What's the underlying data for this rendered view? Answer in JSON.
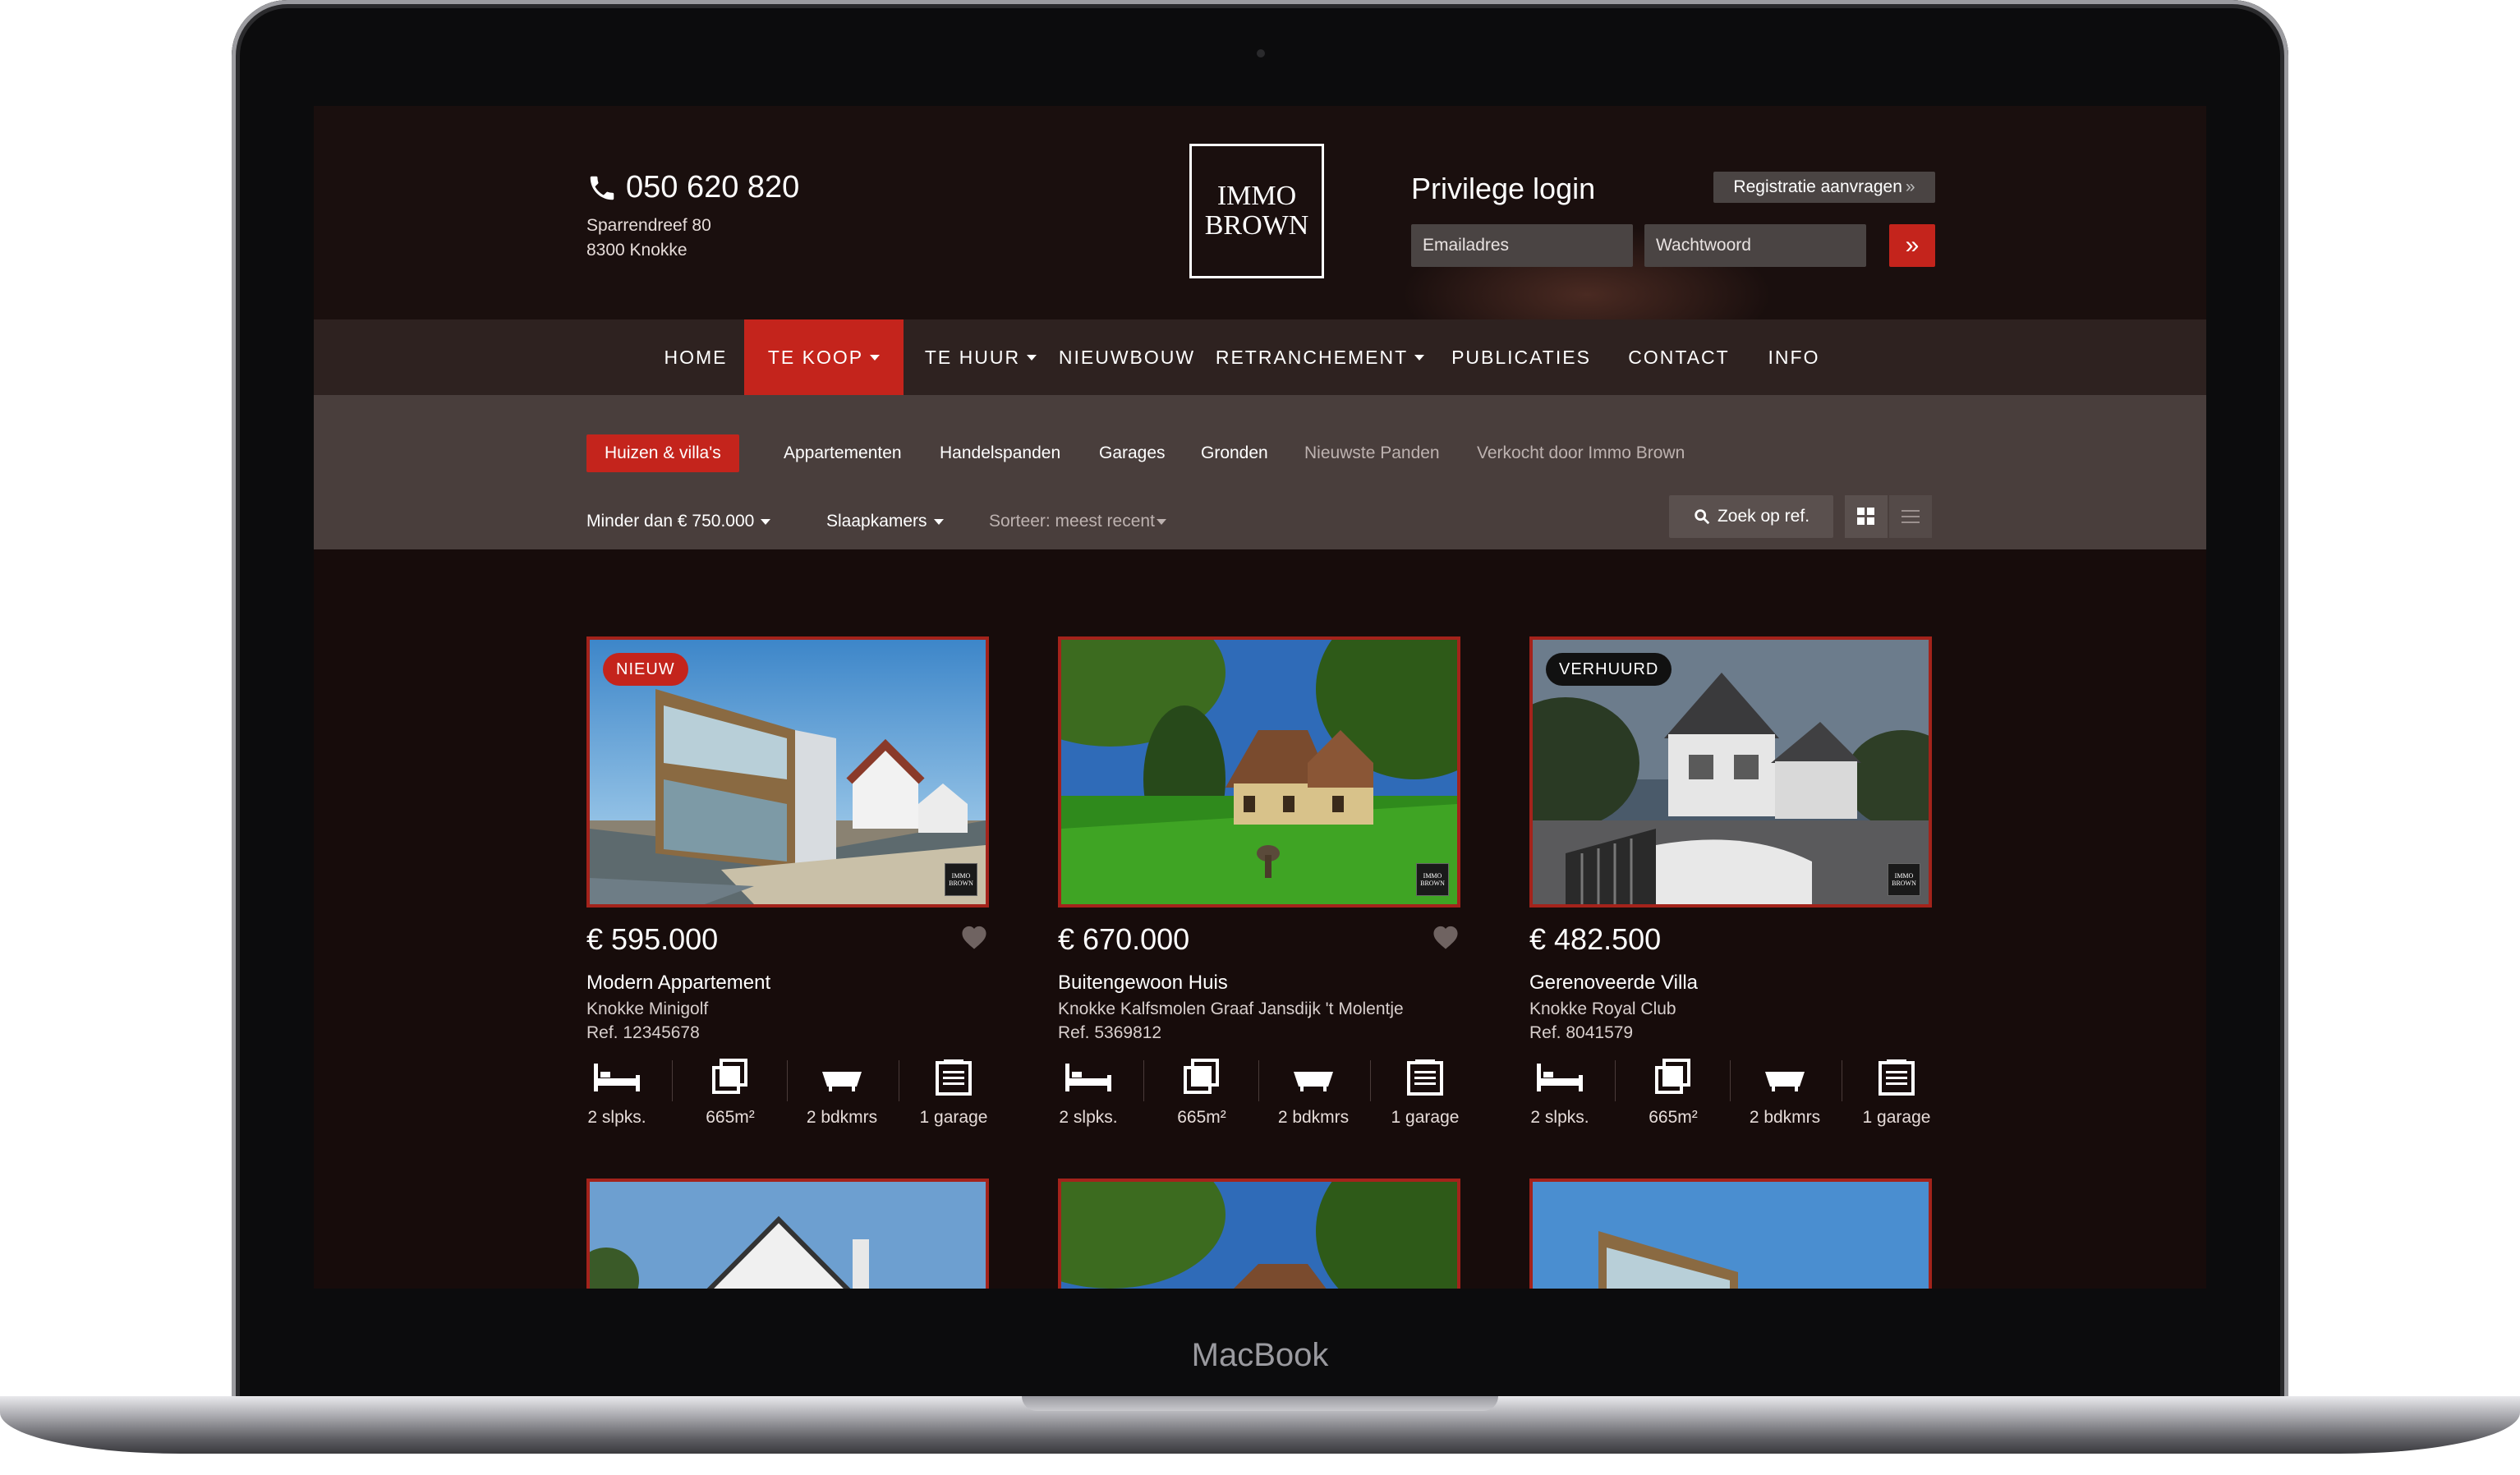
{
  "device_label": "MacBook",
  "header": {
    "phone": "050 620 820",
    "address_line1": "Sparrendreef 80",
    "address_line2": "8300 Knokke",
    "logo_line1": "IMMO",
    "logo_line2": "BROWN",
    "login_title": "Privilege login",
    "register_label": "Registratie aanvragen",
    "email_placeholder": "Emailadres",
    "password_placeholder": "Wachtwoord"
  },
  "nav": {
    "items": [
      {
        "label": "HOME"
      },
      {
        "label": "TE KOOP"
      },
      {
        "label": "TE HUUR"
      },
      {
        "label": "NIEUWBOUW"
      },
      {
        "label": "RETRANCHEMENT"
      },
      {
        "label": "PUBLICATIES"
      },
      {
        "label": "CONTACT"
      },
      {
        "label": "INFO"
      }
    ],
    "active": "TE KOOP"
  },
  "subnav": {
    "tabs": [
      {
        "label": "Huizen & villa's"
      },
      {
        "label": "Appartementen"
      },
      {
        "label": "Handelspanden"
      },
      {
        "label": "Garages"
      },
      {
        "label": "Gronden"
      },
      {
        "label": "Nieuwste Panden"
      },
      {
        "label": "Verkocht door Immo Brown"
      }
    ],
    "active": "Huizen & villa's"
  },
  "filters": {
    "price": "Minder dan € 750.000",
    "bedrooms": "Slaapkamers",
    "sort": "Sorteer: meest recent",
    "search_ref": "Zoek op ref."
  },
  "colors": {
    "accent": "#c4241c",
    "background": "#170c0b",
    "nav_bg": "#2e2220",
    "subbar_bg": "#493e3c"
  },
  "listings": [
    {
      "badge": "NIEUW",
      "price": "€ 595.000",
      "title": "Modern Appartement",
      "location": "Knokke Minigolf",
      "ref": "Ref. 12345678",
      "bedrooms": "2 slpks.",
      "area": "665m²",
      "bathrooms": "2 bdkmrs",
      "garage": "1 garage"
    },
    {
      "badge": "",
      "price": "€ 670.000",
      "title": "Buitengewoon Huis",
      "location": "Knokke Kalfsmolen Graaf Jansdijk 't Molentje",
      "ref": "Ref. 5369812",
      "bedrooms": "2 slpks.",
      "area": "665m²",
      "bathrooms": "2 bdkmrs",
      "garage": "1 garage"
    },
    {
      "badge": "VERHUURD",
      "price": "€ 482.500",
      "title": "Gerenoveerde Villa",
      "location": "Knokke Royal Club",
      "ref": "Ref. 8041579",
      "bedrooms": "2 slpks.",
      "area": "665m²",
      "bathrooms": "2 bdkmrs",
      "garage": "1 garage"
    }
  ],
  "icons": [
    "phone-icon",
    "double-chevron-icon",
    "search-icon",
    "grid-view-icon",
    "list-view-icon",
    "heart-icon",
    "bed-icon",
    "area-icon",
    "bathtub-icon",
    "garage-icon"
  ]
}
